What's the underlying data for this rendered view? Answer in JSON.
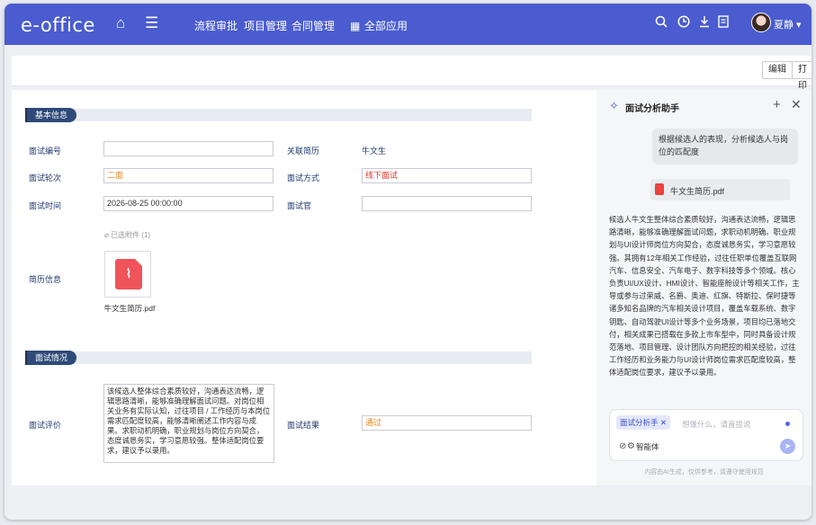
{
  "header": {
    "logo": "e-office",
    "nav": [
      "流程审批",
      "项目管理",
      "合同管理"
    ],
    "all_apps": "全部应用",
    "username": "夏静"
  },
  "toolbar": {
    "edit": "编辑",
    "print": "打印"
  },
  "basic": {
    "section": "基本信息",
    "interview_no_label": "面试编号",
    "interview_no_value": "",
    "resume_label": "关联简历",
    "resume_value": "牛文生",
    "round_label": "面试轮次",
    "round_value": "二面",
    "method_label": "面试方式",
    "method_value": "线下面试",
    "time_label": "面试时间",
    "time_value": "2026-08-25 00:00:00",
    "interviewer_label": "面试官",
    "interviewer_value": "",
    "attach_label": "已选附件",
    "attach_count": "(1)",
    "resume_info_label": "简历信息",
    "file_name": "牛文生简历.pdf"
  },
  "situation": {
    "section": "面试情况",
    "eval_label": "面试评价",
    "eval_text": "该候选人整体综合素质较好，沟通表达流畅，逻辑思路清晰，能够准确理解面试问题。对岗位相关业务有实际认知，过往项目 / 工作经历与本岗位需求匹配度较高，能够清晰阐述工作内容与成果。求职动机明确，职业规划与岗位方向契合，态度诚恳务实，学习意愿较强。整体适配岗位要求，建议予以录用。",
    "result_label": "面试结果",
    "result_value": "通过"
  },
  "assistant": {
    "title": "面试分析助手",
    "user_msg": "根据候选人的表现，分析候选人与岗位的匹配度",
    "file": "牛文生简历.pdf",
    "reply": "候选人牛文生整体综合素质较好，沟通表达流畅，逻辑思路清晰，能够准确理解面试问题，求职动机明确。职业规划与UI设计师岗位方向契合，态度诚恳务实，学习意愿较强。其拥有12年相关工作经验，过往任职单位覆盖互联网汽车、信息安全、汽车电子、数字科技等多个领域。核心负责UI/UX设计、HMI设计、智能座舱设计等相关工作，主导或参与过荣威、名爵、奥迪、红旗、特斯拉、保时捷等诸多知名品牌的汽车相关设计项目，覆盖车载系统、数字钥匙、自动驾驶UI设计等多个业务场景，项目均已落地交付，相关成果已搭载在多款上市车型中，同时具备设计规范落地、项目管理、设计团队方向把控的相关经验，过往工作经历和业务能力与UI设计师岗位需求匹配度较高，整体适配岗位要求，建议予以录用。",
    "chip": "面试分析手",
    "placeholder": "想做什么，请直接说",
    "smart": "智能体",
    "disclaimer": "内容由AI生成，仅供参考，请遵守使用规范"
  }
}
